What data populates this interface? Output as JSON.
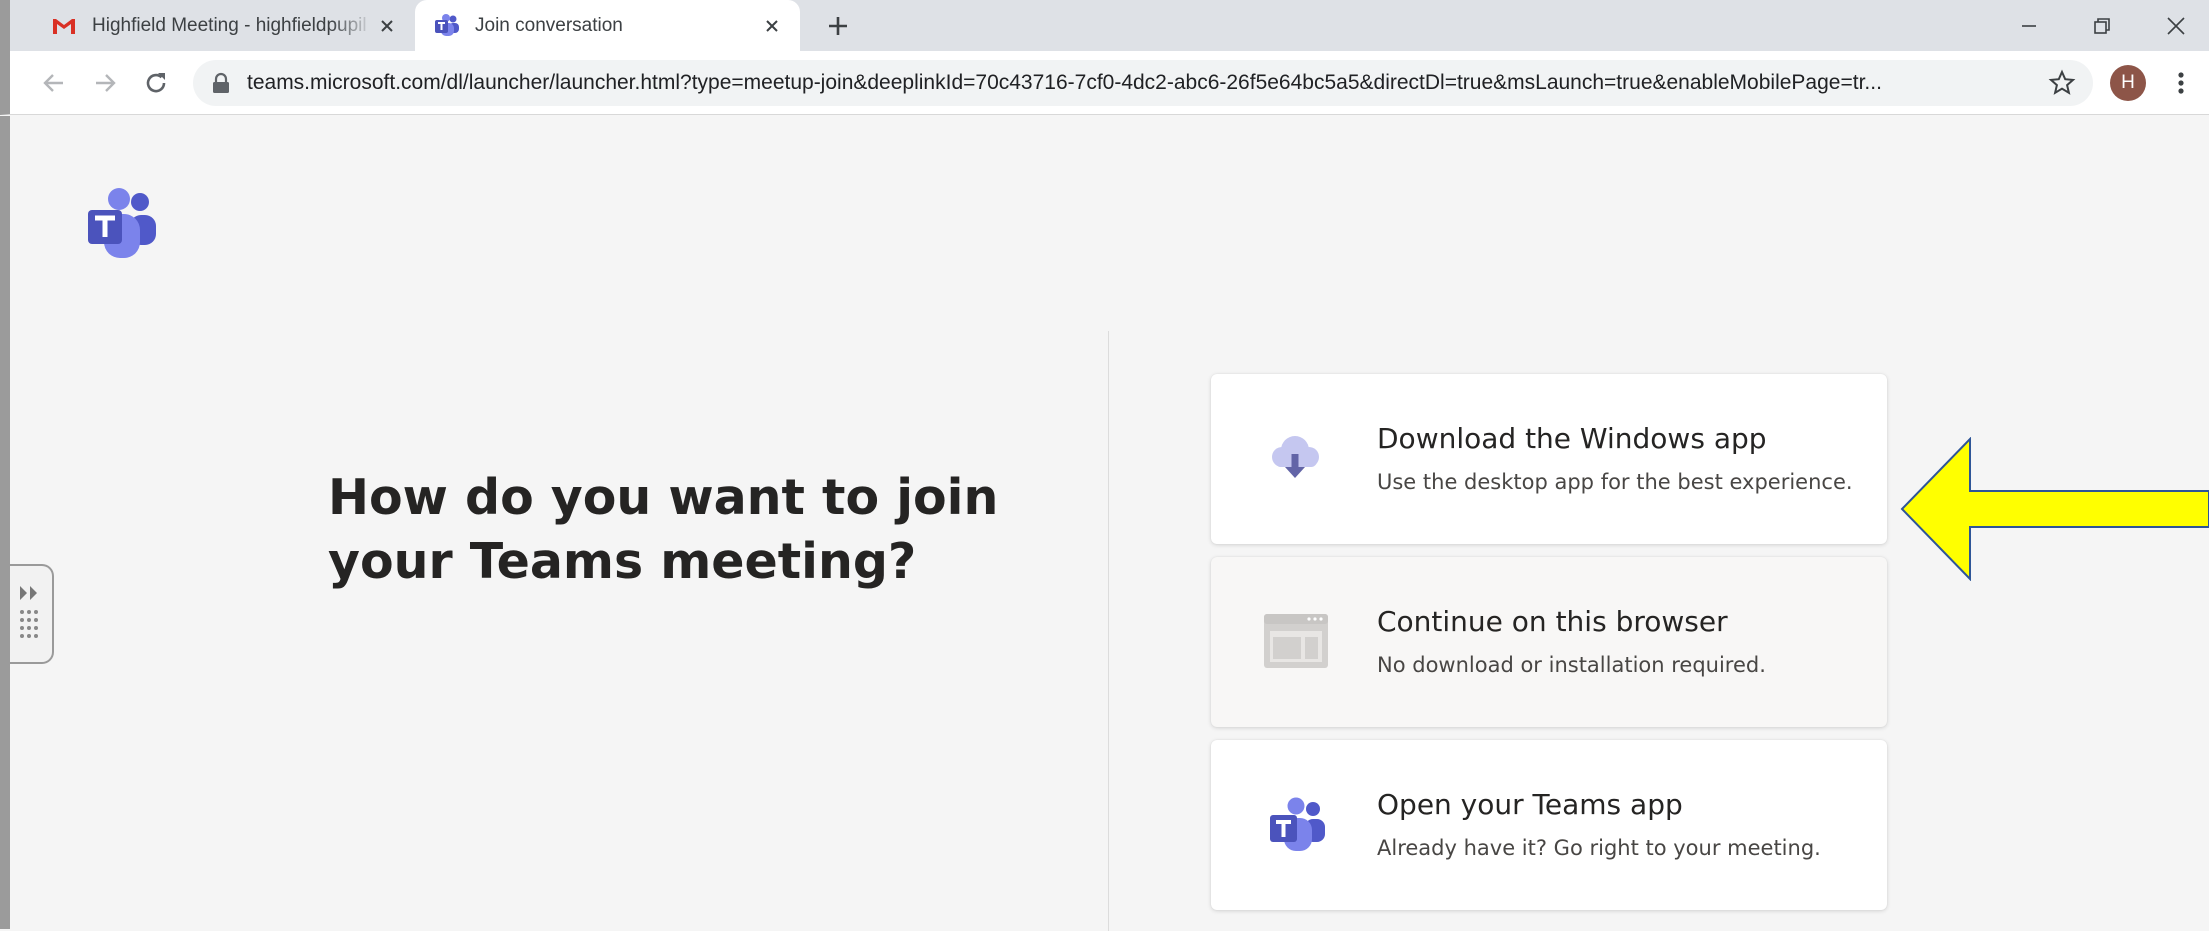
{
  "tabs": [
    {
      "title": "Highfield Meeting - highfieldpupil",
      "favicon": "gmail-icon",
      "active": false
    },
    {
      "title": "Join conversation",
      "favicon": "teams-icon",
      "active": true
    }
  ],
  "toolbar": {
    "url": "teams.microsoft.com/dl/launcher/launcher.html?type=meetup-join&deeplinkId=70c43716-7cf0-4dc2-abc6-26f5e64bc5a5&directDl=true&msLaunch=true&enableMobilePage=tr...",
    "avatar_initial": "H"
  },
  "page": {
    "heading": "How do you want to join your Teams meeting?",
    "options": [
      {
        "title": "Download the Windows app",
        "subtitle": "Use the desktop app for the best experience.",
        "icon": "cloud-download-icon"
      },
      {
        "title": "Continue on this browser",
        "subtitle": "No download or installation required.",
        "icon": "browser-window-icon"
      },
      {
        "title": "Open your Teams app",
        "subtitle": "Already have it? Go right to your meeting.",
        "icon": "teams-icon"
      }
    ]
  },
  "colors": {
    "teams_purple": "#5059c9",
    "teams_purple_light": "#7b83eb",
    "highlight_arrow": "#ffff00",
    "arrow_outline": "#2e5597"
  }
}
